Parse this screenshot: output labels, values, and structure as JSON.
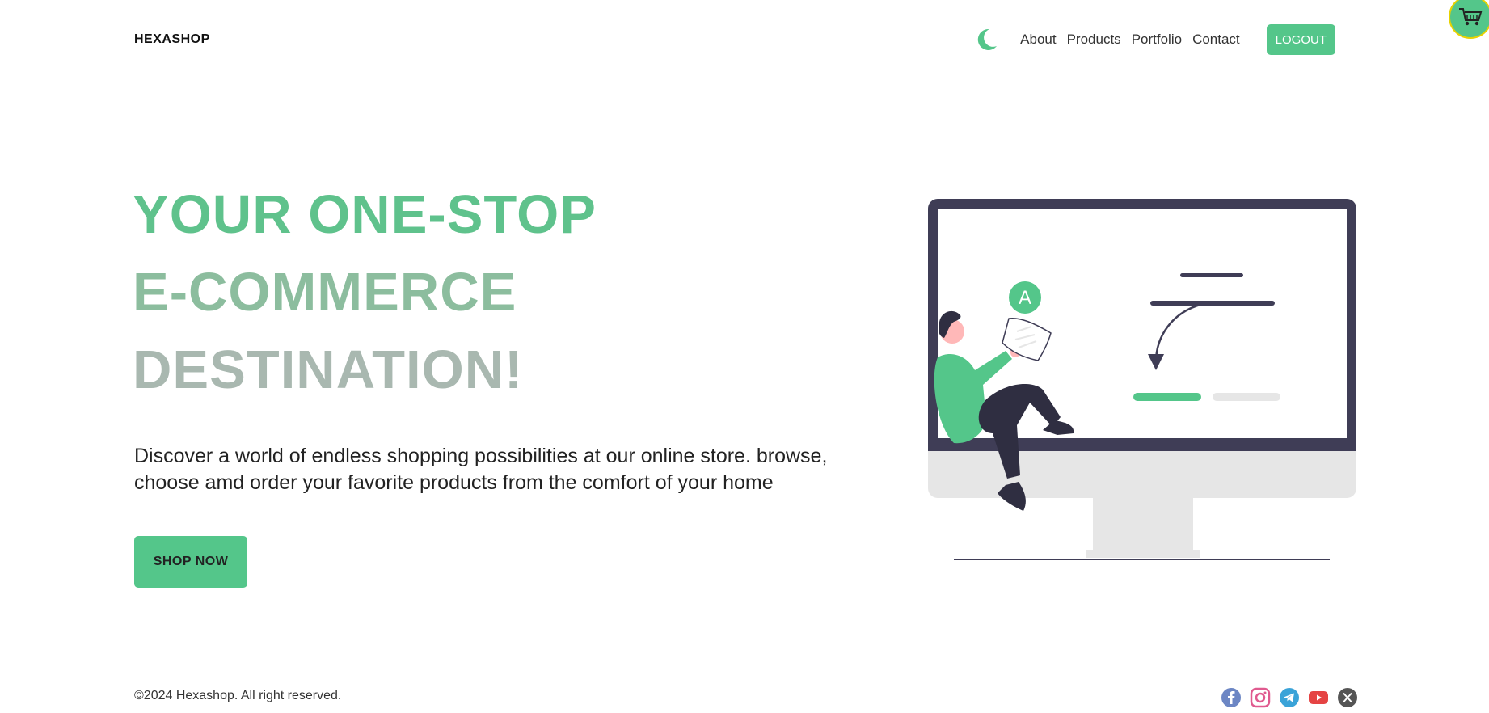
{
  "brand": {
    "name": "HEXASHOP"
  },
  "nav": {
    "theme_toggle_icon": "moon-icon",
    "links": [
      "About",
      "Products",
      "Portfolio",
      "Contact"
    ],
    "logout_label": "LOGOUT"
  },
  "cart": {
    "icon": "cart-icon"
  },
  "hero": {
    "title_lines": [
      "YOUR ONE-STOP",
      "E-COMMERCE",
      "DESTINATION!"
    ],
    "description": "Discover a world of endless shopping possibilities at our online store. browse, choose amd order your favorite products from the comfort of your home",
    "cta_label": "SHOP NOW",
    "illustration_badge": "A"
  },
  "footer": {
    "copyright": "©2024 Hexashop. All right reserved.",
    "social_icons": [
      "facebook-icon",
      "instagram-icon",
      "telegram-icon",
      "youtube-icon",
      "x-icon"
    ]
  },
  "colors": {
    "accent": "#54c68a",
    "title_line1": "#5fc28c",
    "title_line2": "#8cbd9e",
    "title_line3": "#a9b8b0",
    "monitor_frame": "#3f3d56",
    "monitor_stand": "#e6e6e6",
    "cart_border": "#e8d200"
  }
}
